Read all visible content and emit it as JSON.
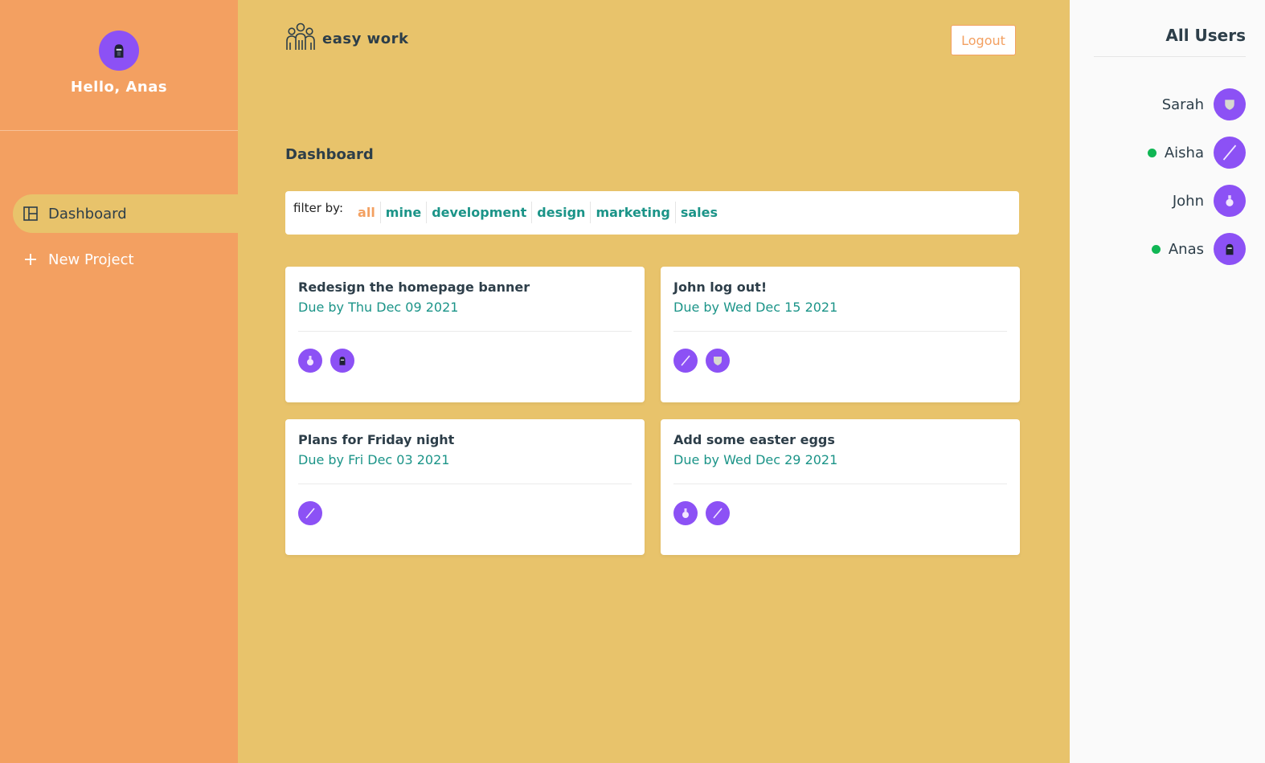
{
  "sidebar": {
    "greeting": "Hello, Anas",
    "user_avatar": "knight-helmet-icon",
    "nav": [
      {
        "label": "Dashboard",
        "icon": "layout-icon",
        "active": true
      },
      {
        "label": "New Project",
        "icon": "plus-icon",
        "active": false
      }
    ]
  },
  "header": {
    "brand": "easy work",
    "brand_icon": "team-icon",
    "logout_label": "Logout"
  },
  "main": {
    "title": "Dashboard",
    "filter": {
      "label": "filter by:",
      "options": [
        "all",
        "mine",
        "development",
        "design",
        "marketing",
        "sales"
      ],
      "selected": "all"
    },
    "projects": [
      {
        "name": "Redesign the homepage banner",
        "due": "Due by Thu Dec 09 2021",
        "assignees": [
          "potion-icon",
          "knight-helmet-icon"
        ]
      },
      {
        "name": "John log out!",
        "due": "Due by Wed Dec 15 2021",
        "assignees": [
          "wand-icon",
          "shield-icon"
        ]
      },
      {
        "name": "Plans for Friday night",
        "due": "Due by Fri Dec 03 2021",
        "assignees": [
          "wand-icon"
        ]
      },
      {
        "name": "Add some easter eggs",
        "due": "Due by Wed Dec 29 2021",
        "assignees": [
          "potion-icon",
          "wand-icon"
        ]
      }
    ]
  },
  "users_panel": {
    "title": "All Users",
    "users": [
      {
        "name": "Sarah",
        "online": false,
        "avatar": "shield-icon"
      },
      {
        "name": "Aisha",
        "online": true,
        "avatar": "wand-icon"
      },
      {
        "name": "John",
        "online": false,
        "avatar": "potion-icon"
      },
      {
        "name": "Anas",
        "online": true,
        "avatar": "knight-helmet-icon"
      }
    ]
  },
  "colors": {
    "sidebar_bg": "#f3a061",
    "main_bg": "#e8c36b",
    "accent_teal": "#1b9488",
    "accent_orange": "#f3a061",
    "avatar_purple": "#8c51f5",
    "online_green": "#10b654",
    "text_dark": "#2d3e49"
  }
}
